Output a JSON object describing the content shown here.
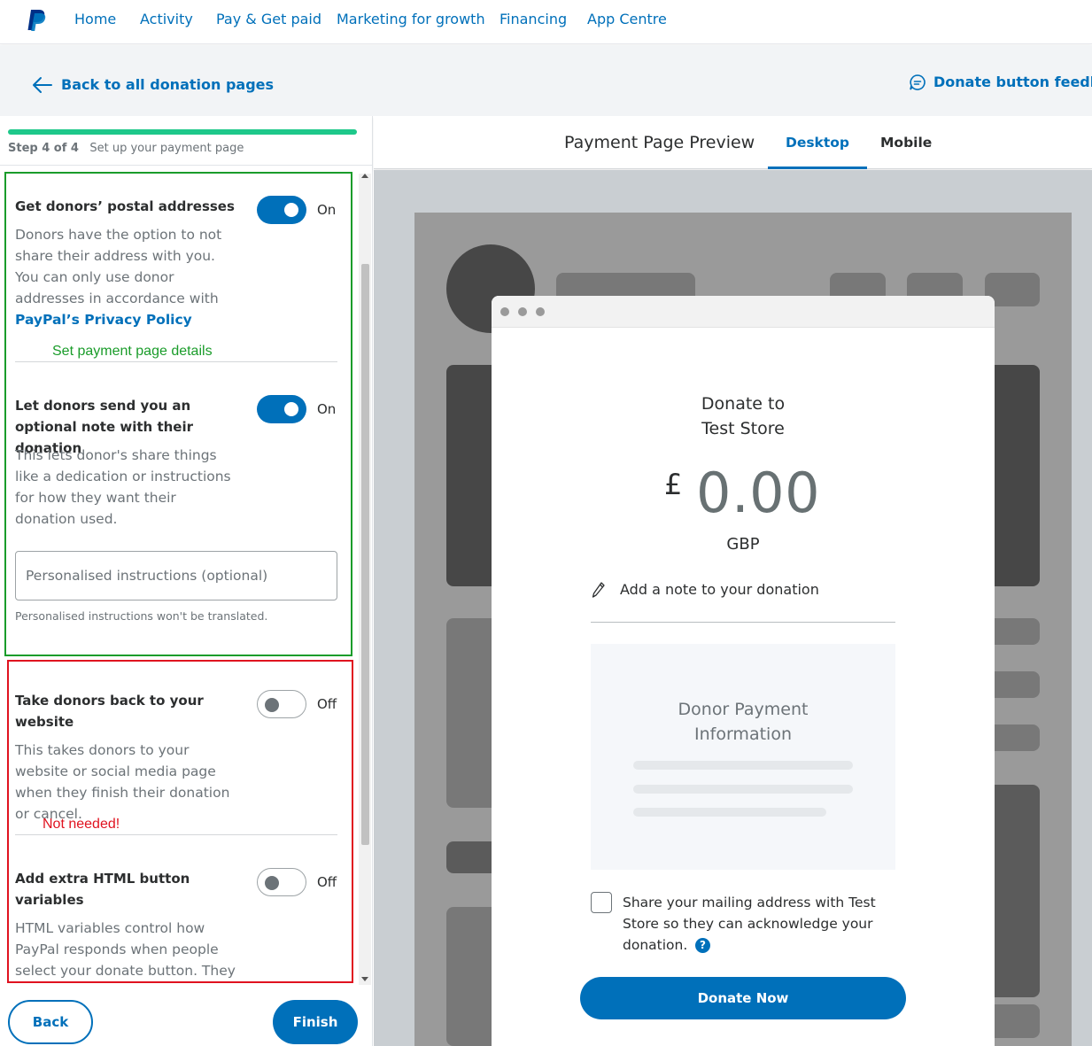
{
  "nav": {
    "items": [
      {
        "label": "Home"
      },
      {
        "label": "Activity"
      },
      {
        "label": "Pay & Get paid"
      },
      {
        "label": "Marketing for growth"
      },
      {
        "label": "Financing"
      },
      {
        "label": "App Centre"
      }
    ]
  },
  "subheader": {
    "back_label": "Back to all donation pages",
    "feedback_label": "Donate button feedback"
  },
  "wizard": {
    "step": "Step 4 of 4",
    "step_title": "Set up your payment page",
    "progress": 1.0
  },
  "settings": [
    {
      "title": "Get donors’ postal addresses",
      "desc": "Donors have the option to not share their address with you. You can only use donor addresses in accordance with ",
      "link": "PayPal’s Privacy Policy",
      "state": "On"
    },
    {
      "title": "Let donors send you an optional note with their donation",
      "desc": "This lets donor's share things like a dedication or instructions for how they want their donation used.",
      "state": "On"
    },
    {
      "title": "Take donors back to your website",
      "desc": "This takes donors to your website or social media page when they finish their donation or cancel.",
      "state": "Off"
    },
    {
      "title": "Add extra HTML button variables",
      "desc": "HTML variables control how PayPal responds when people select your donate button. They",
      "state": "Off"
    }
  ],
  "instructions": {
    "placeholder": "Personalised instructions (optional)",
    "note": "Personalised instructions won't be translated."
  },
  "annotations": {
    "green": "Set payment page details",
    "red": "Not needed!"
  },
  "buttons": {
    "back": "Back",
    "finish": "Finish"
  },
  "preview": {
    "title": "Payment Page Preview",
    "tabs": [
      "Desktop",
      "Mobile"
    ],
    "active_tab": "Desktop",
    "donate_to_line1": "Donate to",
    "donate_to_line2": "Test Store",
    "currency_symbol": "£",
    "amount": "0.00",
    "currency_code": "GBP",
    "add_note": "Add a note to your donation",
    "payment_info_line1": "Donor Payment",
    "payment_info_line2": "Information",
    "share_text": "Share your mailing address with Test Store so they can acknowledge your donation.",
    "help_icon": "?",
    "donate_button": "Donate Now"
  },
  "colors": {
    "brand_blue": "#0070ba",
    "progress_green": "#1ec88a",
    "annotation_green": "#1a9c2a",
    "annotation_red": "#e0121f"
  }
}
